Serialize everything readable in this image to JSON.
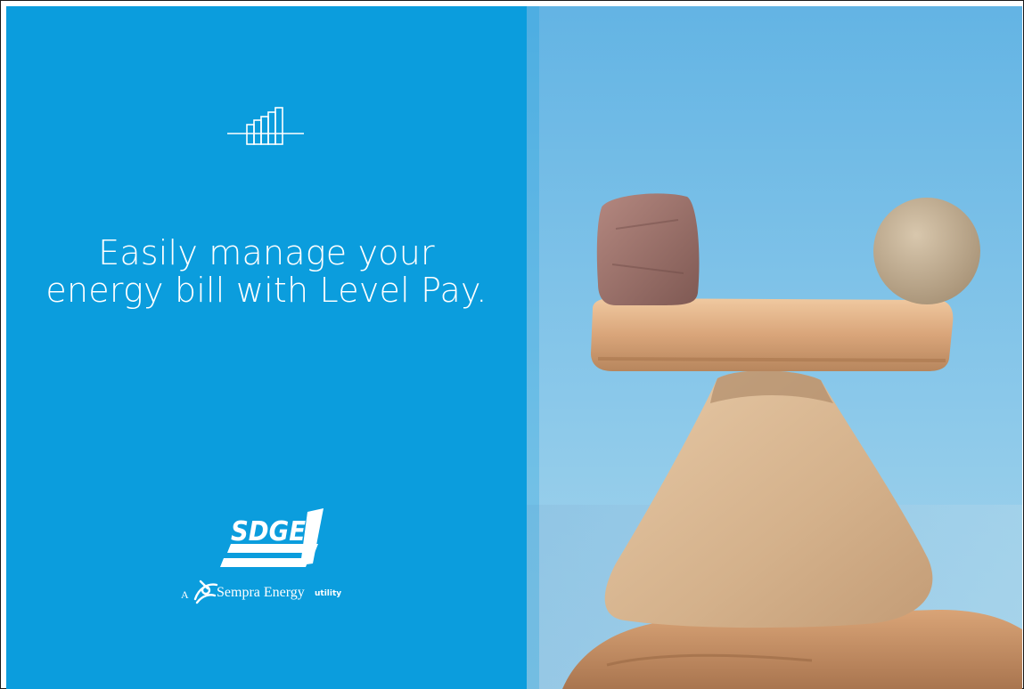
{
  "colors": {
    "panel_blue": "#0b9ddd",
    "text": "#ffffff",
    "sky_top": "#7cc3ea",
    "sky_bottom": "#9ccfe9",
    "stone_sand": "#d8b48c"
  },
  "icons": {
    "bar_chart": "bar-chart-icon",
    "sempra_swoosh": "sempra-swoosh-icon"
  },
  "headline": {
    "line1": "Easily manage your",
    "line2": "energy bill with Level Pay."
  },
  "brand": {
    "logo_text": "SDGE",
    "tagline_prefix": "A",
    "tagline_name": "Sempra Energy",
    "tagline_suffix": "utility"
  },
  "photo": {
    "subject": "balanced stones"
  }
}
